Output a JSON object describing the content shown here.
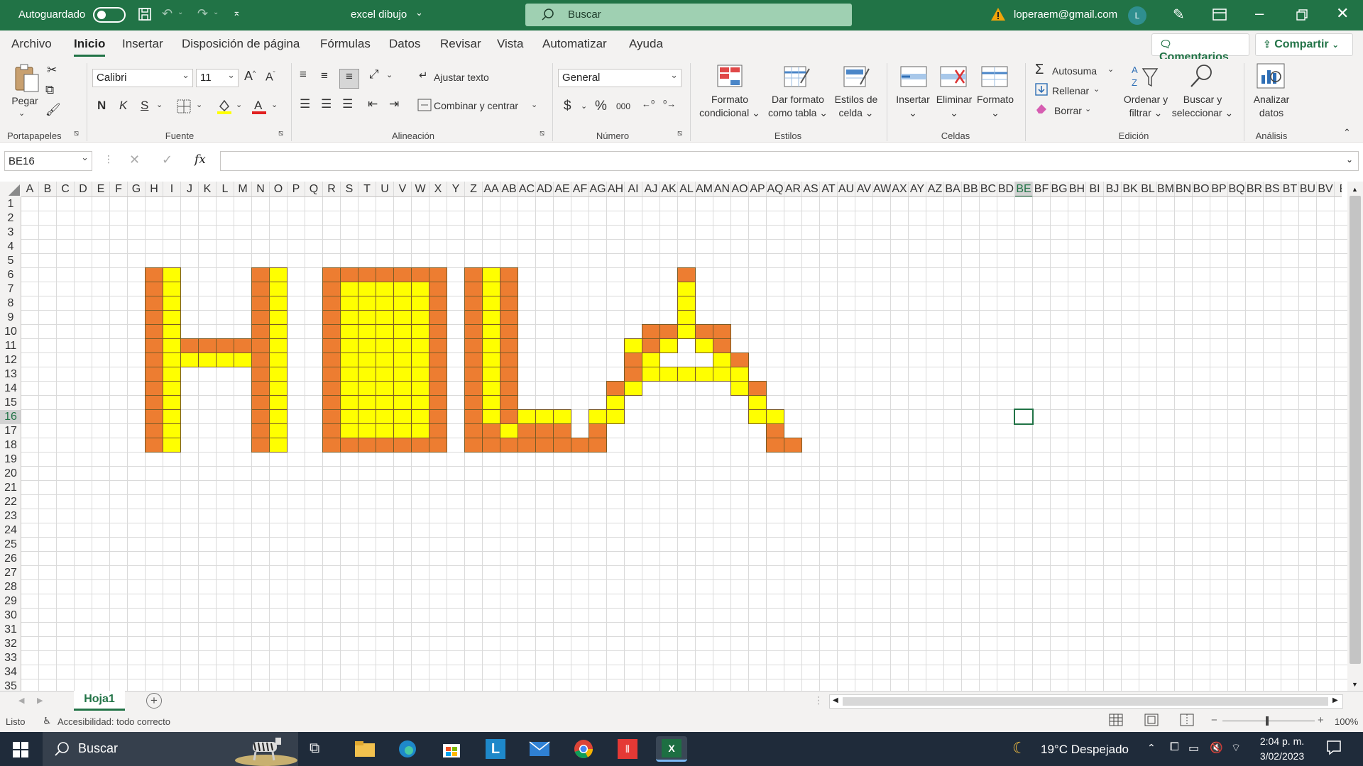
{
  "titlebar": {
    "autosave_label": "Autoguardado",
    "doc_title": "excel dibujo",
    "search_placeholder": "Buscar",
    "account": "loperaem@gmail.com",
    "avatar_initial": "L"
  },
  "menu": {
    "items": [
      "Archivo",
      "Inicio",
      "Insertar",
      "Disposición de página",
      "Fórmulas",
      "Datos",
      "Revisar",
      "Vista",
      "Automatizar",
      "Ayuda"
    ],
    "active": "Inicio",
    "comments_label": "Comentarios",
    "share_label": "Compartir"
  },
  "ribbon": {
    "clipboard": {
      "paste": "Pegar",
      "group": "Portapapeles"
    },
    "font": {
      "name": "Calibri",
      "size": "11",
      "bold": "N",
      "italic": "K",
      "underline": "S",
      "group": "Fuente"
    },
    "alignment": {
      "wrap": "Ajustar texto",
      "merge": "Combinar y centrar",
      "group": "Alineación"
    },
    "number": {
      "format": "General",
      "currency": "$",
      "percent": "%",
      "thousands": "000",
      "group": "Número"
    },
    "styles": {
      "conditional": [
        "Formato",
        "condicional"
      ],
      "table": [
        "Dar formato",
        "como tabla"
      ],
      "cell": [
        "Estilos de",
        "celda"
      ],
      "group": "Estilos"
    },
    "cells": {
      "insert": "Insertar",
      "delete": "Eliminar",
      "format": "Formato",
      "group": "Celdas"
    },
    "editing": {
      "autosum": "Autosuma",
      "fill": "Rellenar",
      "clear": "Borrar",
      "sort": [
        "Ordenar y",
        "filtrar"
      ],
      "find": [
        "Buscar y",
        "seleccionar"
      ],
      "group": "Edición"
    },
    "analysis": {
      "analyze": [
        "Analizar",
        "datos"
      ],
      "group": "Análisis"
    }
  },
  "formula": {
    "name_box": "BE16",
    "fx": "fx",
    "value": ""
  },
  "grid": {
    "columns": [
      "A",
      "B",
      "C",
      "D",
      "E",
      "F",
      "G",
      "H",
      "I",
      "J",
      "K",
      "L",
      "M",
      "N",
      "O",
      "P",
      "Q",
      "R",
      "S",
      "T",
      "U",
      "V",
      "W",
      "X",
      "Y",
      "Z",
      "AA",
      "AB",
      "AC",
      "AD",
      "AE",
      "AF",
      "AG",
      "AH",
      "AI",
      "AJ",
      "AK",
      "AL",
      "AM",
      "AN",
      "AO",
      "AP",
      "AQ",
      "AR",
      "AS",
      "AT",
      "AU",
      "AV",
      "AW",
      "AX",
      "AY",
      "AZ",
      "BA",
      "BB",
      "BC",
      "BD",
      "BE",
      "BF",
      "BG",
      "BH",
      "BI",
      "BJ",
      "BK",
      "BL",
      "BM",
      "BN",
      "BO",
      "BP",
      "BQ",
      "BR",
      "BS",
      "BT",
      "BU",
      "BV",
      "B"
    ],
    "rows": [
      "1",
      "2",
      "3",
      "4",
      "5",
      "6",
      "7",
      "8",
      "9",
      "10",
      "11",
      "12",
      "13",
      "14",
      "15",
      "16",
      "17",
      "18",
      "19",
      "20",
      "21",
      "22",
      "23",
      "24",
      "25",
      "26",
      "27",
      "28",
      "29",
      "30",
      "31",
      "32",
      "33",
      "34",
      "35"
    ],
    "selected_cell": "BE16",
    "colors": {
      "orange": "#ED7D31",
      "yellow": "#FFFF00"
    },
    "drawing": {
      "O": [
        "H6",
        "H7",
        "H8",
        "H9",
        "H10",
        "H11",
        "H12",
        "H13",
        "H14",
        "H15",
        "H16",
        "H17",
        "H18",
        "N6",
        "N7",
        "N8",
        "N9",
        "N10",
        "N11",
        "N12",
        "N13",
        "N14",
        "N15",
        "N16",
        "N17",
        "N18",
        "J11",
        "K11",
        "L11",
        "M11",
        "R6",
        "R7",
        "R8",
        "R9",
        "R10",
        "R11",
        "R12",
        "R13",
        "R14",
        "R15",
        "R16",
        "R17",
        "R18",
        "S6",
        "T6",
        "U6",
        "V6",
        "W6",
        "X6",
        "X7",
        "X8",
        "X9",
        "X10",
        "X11",
        "X12",
        "X13",
        "X14",
        "X15",
        "X16",
        "X17",
        "X18",
        "S18",
        "T18",
        "U18",
        "V18",
        "W18",
        "Z6",
        "Z7",
        "Z8",
        "Z9",
        "Z10",
        "Z11",
        "Z12",
        "Z13",
        "Z14",
        "Z15",
        "Z16",
        "Z17",
        "Z18",
        "AB6",
        "AB7",
        "AB8",
        "AB9",
        "AB10",
        "AB11",
        "AB12",
        "AB13",
        "AB14",
        "AB15",
        "AB16",
        "AC17",
        "AD17",
        "AE17",
        "AB18",
        "AC18",
        "AD18",
        "AE18",
        "AF18",
        "AG18",
        "AG17",
        "AH14",
        "AI13",
        "AJ10",
        "AJ11",
        "AI12",
        "AK10",
        "AL6",
        "AM10",
        "AN10",
        "AN11",
        "AO12",
        "AP14",
        "AQ17",
        "AQ18",
        "AR18",
        "AA17",
        "AA18"
      ],
      "Y": [
        "I6",
        "I7",
        "I8",
        "I9",
        "I10",
        "I11",
        "I12",
        "I13",
        "I14",
        "I15",
        "I16",
        "I17",
        "I18",
        "O6",
        "O7",
        "O8",
        "O9",
        "O10",
        "O11",
        "O12",
        "O13",
        "O14",
        "O15",
        "O16",
        "O17",
        "O18",
        "I12",
        "J12",
        "K12",
        "L12",
        "M12",
        "S7",
        "S8",
        "S9",
        "S10",
        "S11",
        "S12",
        "S13",
        "S14",
        "S15",
        "S16",
        "S17",
        "T7",
        "T8",
        "T9",
        "T10",
        "T11",
        "T12",
        "T13",
        "T14",
        "T15",
        "T16",
        "T17",
        "U7",
        "U8",
        "U9",
        "U10",
        "U11",
        "U12",
        "U13",
        "U14",
        "U15",
        "U16",
        "U17",
        "V7",
        "V8",
        "V9",
        "V10",
        "V11",
        "V12",
        "V13",
        "V14",
        "V15",
        "V16",
        "V17",
        "W7",
        "W8",
        "W9",
        "W10",
        "W11",
        "W12",
        "W13",
        "W14",
        "W15",
        "W16",
        "W17",
        "AA6",
        "AA7",
        "AA8",
        "AA9",
        "AA10",
        "AA11",
        "AA12",
        "AA13",
        "AA14",
        "AA15",
        "AA16",
        "AB17",
        "AC16",
        "AD16",
        "AE16",
        "AG16",
        "AH15",
        "AH16",
        "AI14",
        "AJ12",
        "AJ13",
        "AI11",
        "AK13",
        "AL7",
        "AL8",
        "AL9",
        "AL13",
        "AM13",
        "AM11",
        "AN12",
        "AN13",
        "AO13",
        "AO14",
        "AP15",
        "AP16",
        "AQ16",
        "AK11",
        "AL10"
      ]
    }
  },
  "sheets": {
    "tabs": [
      "Hoja1"
    ],
    "active": "Hoja1"
  },
  "status": {
    "ready": "Listo",
    "accessibility": "Accesibilidad: todo correcto",
    "zoom": "100%"
  },
  "taskbar": {
    "search": "Buscar",
    "weather": "19°C  Despejado",
    "time": "2:04 p. m.",
    "date": "3/02/2023"
  }
}
